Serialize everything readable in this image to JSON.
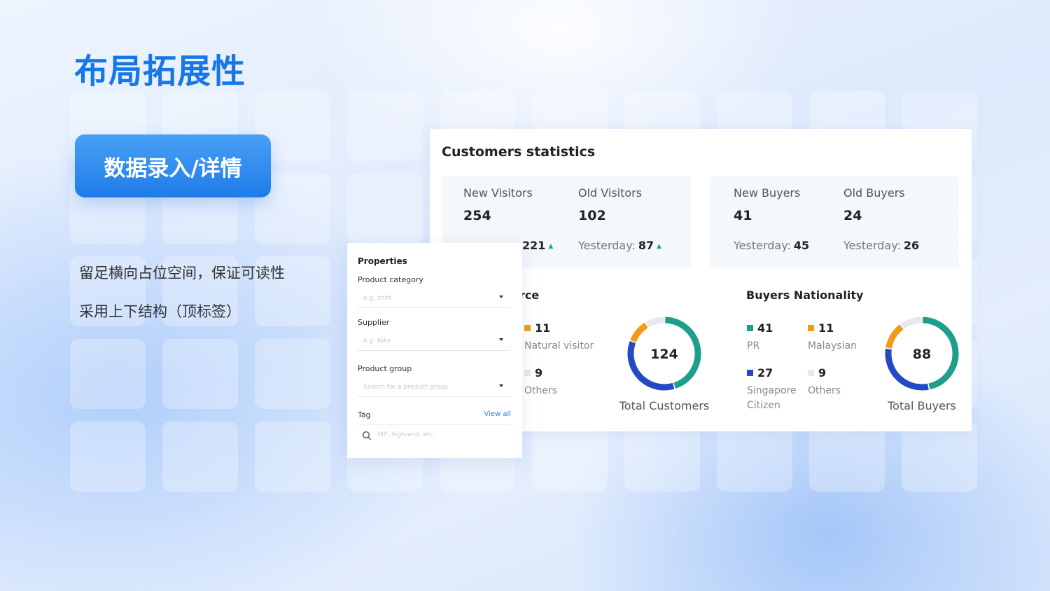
{
  "slide": {
    "title": "布局拓展性",
    "cta_label": "数据录入/详情",
    "notes": [
      "留足横向占位空间，保证可读性",
      "采用上下结构（顶标签）"
    ]
  },
  "stats": {
    "title": "Customers statistics",
    "visitors": [
      {
        "label": "New Visitors",
        "value": "254",
        "yesterday_label": "",
        "yesterday_value": "221"
      },
      {
        "label": "Old Visitors",
        "value": "102",
        "yesterday_label": "Yesterday:",
        "yesterday_value": "87"
      }
    ],
    "buyers": [
      {
        "label": "New Buyers",
        "value": "41",
        "yesterday_label": "Yesterday:",
        "yesterday_value": "45"
      },
      {
        "label": "Old Buyers",
        "value": "24",
        "yesterday_label": "Yesterday:",
        "yesterday_value": "26"
      }
    ],
    "source": {
      "title_fragment": "rce",
      "items": [
        {
          "value": "11",
          "label": "Natural visitor"
        },
        {
          "value": "9",
          "label": "Others"
        }
      ],
      "total": "124",
      "total_caption": "Total Customers",
      "donut": [
        {
          "value": 56,
          "color": "#1e9e8c"
        },
        {
          "value": 44,
          "color": "#2349c5"
        },
        {
          "value": 13,
          "color": "#f29a1a"
        },
        {
          "value": 11,
          "color": "#e6e8ec"
        }
      ]
    },
    "nationality": {
      "title": "Buyers Nationality",
      "items": [
        {
          "value": "41",
          "label": "PR",
          "color": "#1e9e8c"
        },
        {
          "value": "11",
          "label": "Malaysian",
          "color": "#f29a1a"
        },
        {
          "value": "27",
          "label": "Singapore Citizen",
          "color": "#2349c5"
        },
        {
          "value": "9",
          "label": "Others",
          "color": "#e6e8ec"
        }
      ],
      "total": "88",
      "total_caption": "Total Buyers",
      "donut": [
        {
          "value": 41,
          "color": "#1e9e8c"
        },
        {
          "value": 27,
          "color": "#2349c5"
        },
        {
          "value": 11,
          "color": "#f29a1a"
        },
        {
          "value": 9,
          "color": "#e6e8ec"
        }
      ]
    }
  },
  "form": {
    "heading": "Properties",
    "product_category": {
      "label": "Product category",
      "placeholder": "e.g. shirt"
    },
    "supplier": {
      "label": "Supplier",
      "placeholder": "e.g. Nike"
    },
    "product_group": {
      "label": "Product group",
      "placeholder": "Search for a product group"
    },
    "tag": {
      "label": "Tag",
      "view_all": "View all",
      "placeholder": "VIP, high-end, etc."
    }
  }
}
